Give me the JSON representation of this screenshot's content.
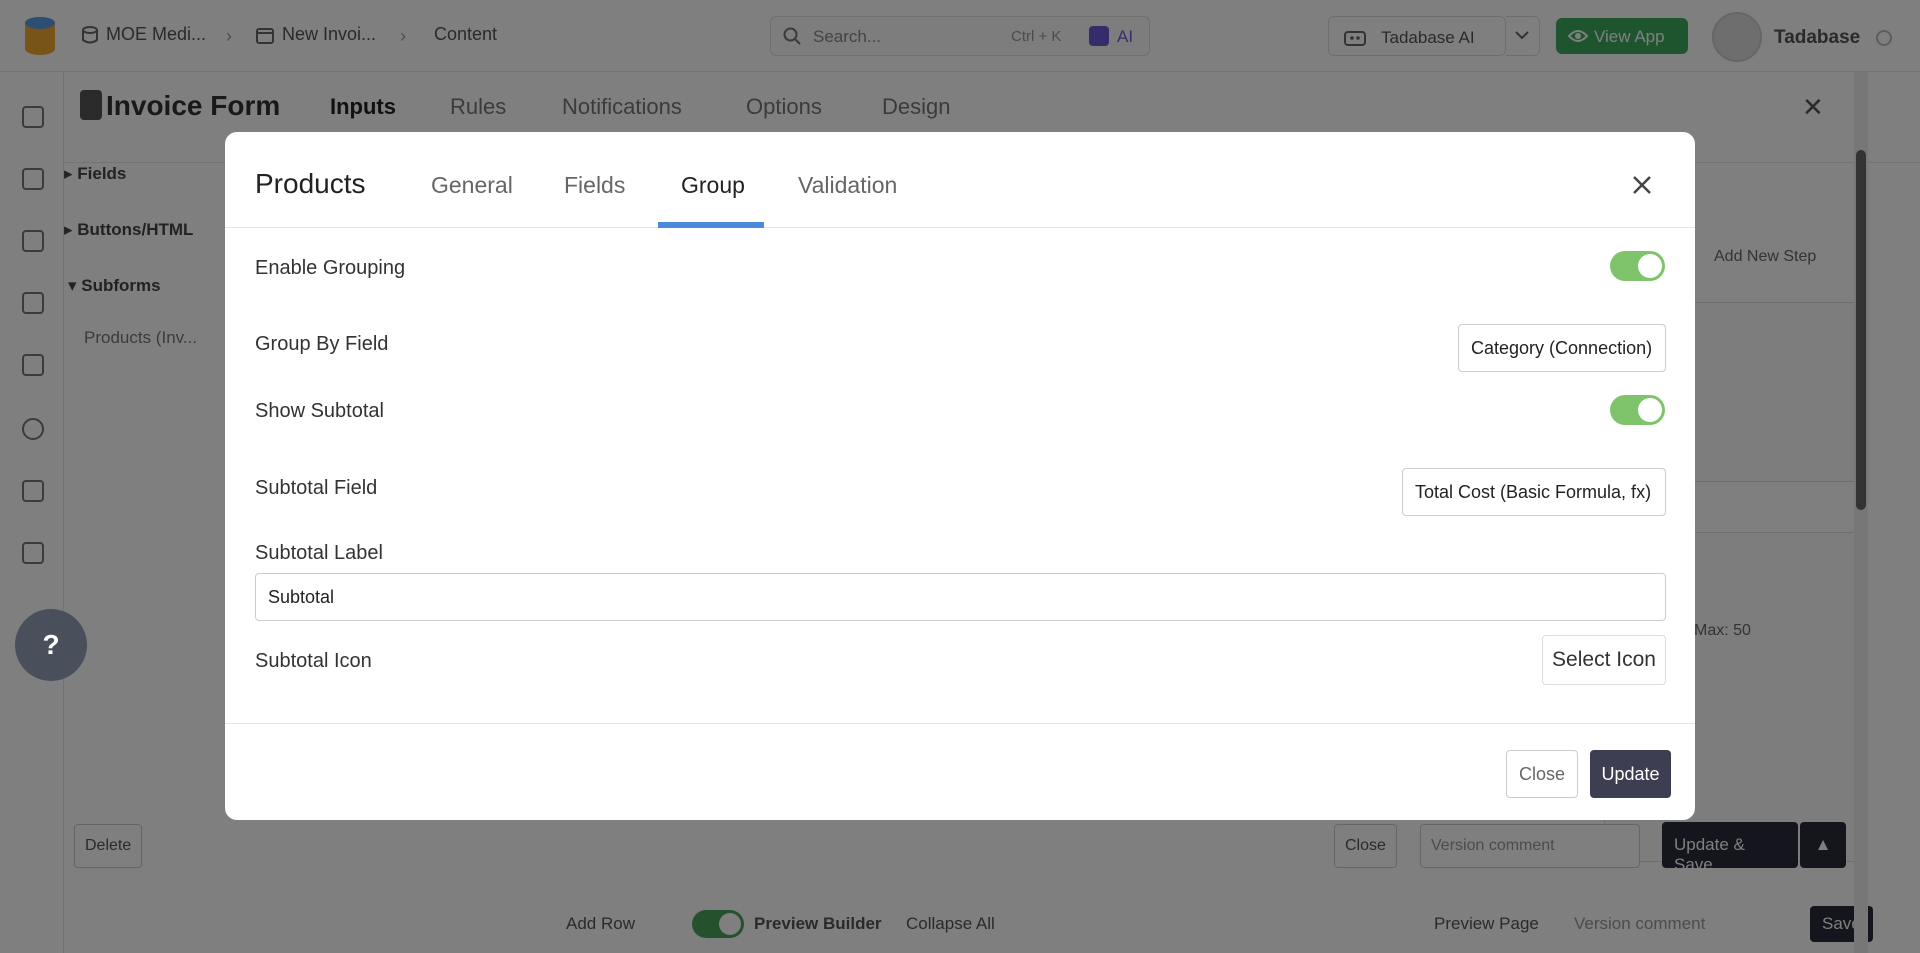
{
  "topbar": {
    "crumbs": [
      "MOE Medi...",
      "New Invoi...",
      "Content"
    ],
    "search_placeholder": "Search...",
    "search_shortcut": "Ctrl + K",
    "ai_label": "AI",
    "tadabase_ai": "Tadabase AI",
    "view_app": "View App",
    "user_name": "Tadabase"
  },
  "builder": {
    "title": "Invoice Form",
    "tabs": [
      "Inputs",
      "Rules",
      "Notifications",
      "Options",
      "Design"
    ],
    "sidebar": [
      "Fields",
      "Buttons/HTML",
      "Subforms",
      "Products (Inv..."
    ],
    "canvas_add_step": "Add New Step",
    "canvas_max": "Max: 50",
    "bottom": {
      "delete": "Delete",
      "close": "Close",
      "version_comment": "Version comment",
      "update_save": "Update & Save"
    },
    "toolbar": {
      "add_row": "Add Row",
      "preview_builder": "Preview Builder",
      "collapse_all": "Collapse All",
      "preview_page": "Preview Page",
      "version_comment": "Version comment",
      "save": "Save"
    }
  },
  "help_label": "?",
  "modal": {
    "title": "Products",
    "tabs": [
      "General",
      "Fields",
      "Group",
      "Validation"
    ],
    "active_tab": "Group",
    "enable_grouping_label": "Enable Grouping",
    "enable_grouping": true,
    "group_by_label": "Group By Field",
    "group_by_value": "Category (Connection)",
    "show_subtotal_label": "Show Subtotal",
    "show_subtotal": true,
    "subtotal_field_label": "Subtotal Field",
    "subtotal_field_value": "Total Cost (Basic Formula, fx)",
    "subtotal_label_label": "Subtotal Label",
    "subtotal_label_value": "Subtotal",
    "subtotal_icon_label": "Subtotal Icon",
    "select_icon": "Select Icon",
    "close_button": "Close",
    "update_button": "Update"
  },
  "colors": {
    "toggle_on": "#7fc36b",
    "tab_underline": "#4a89dc",
    "update_bg": "#3d3e52",
    "view_app_bg": "#3cab5d"
  }
}
